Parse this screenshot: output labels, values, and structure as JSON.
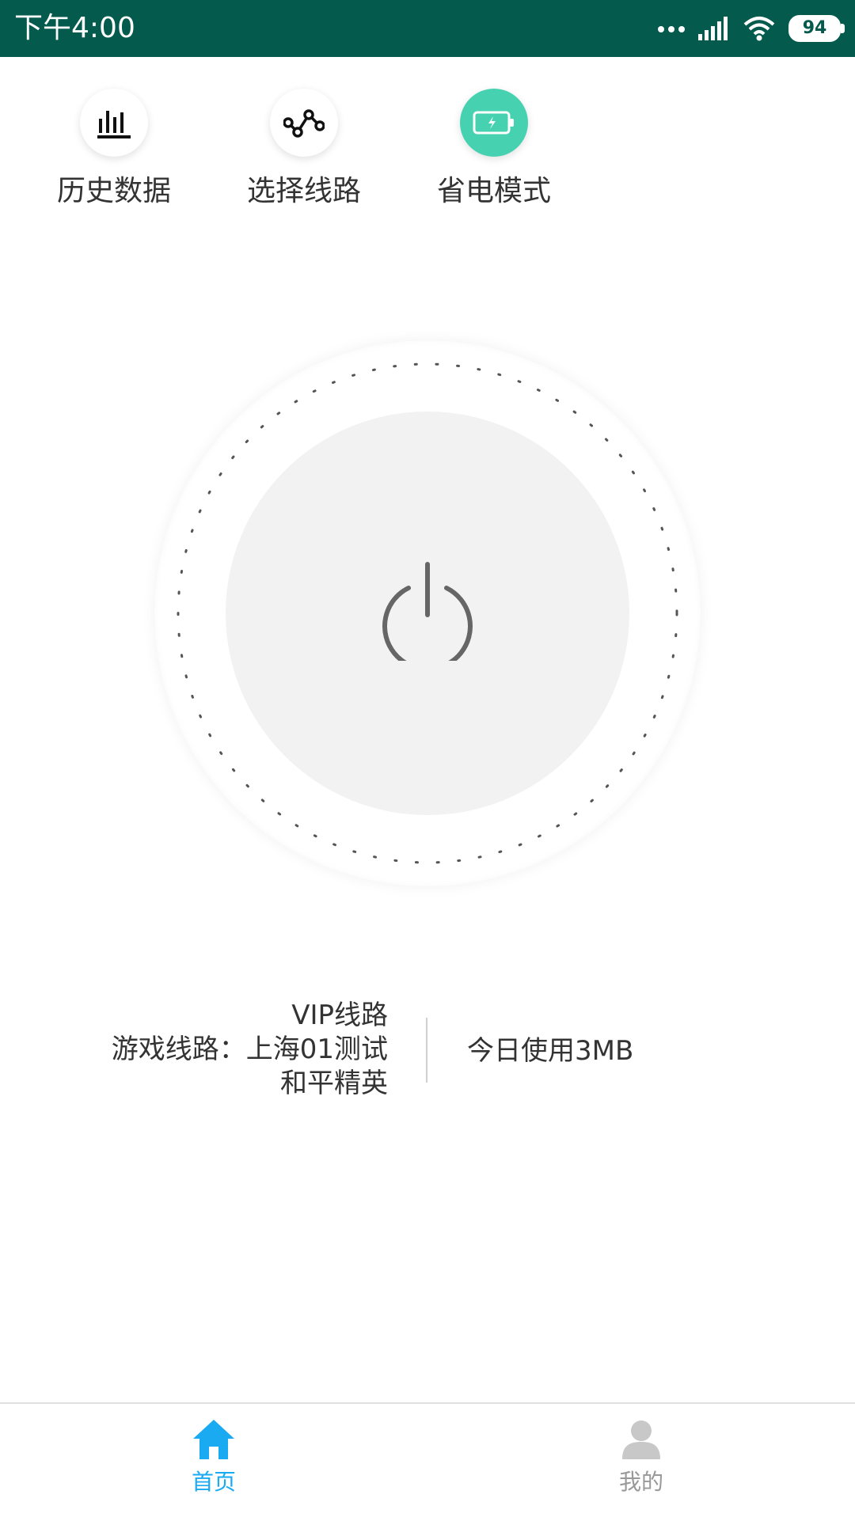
{
  "status_bar": {
    "time": "下午4:00",
    "battery": "94",
    "background": "#035a4d"
  },
  "actions": [
    {
      "label": "历史数据",
      "icon": "bar-chart-icon",
      "active": false
    },
    {
      "label": "选择线路",
      "icon": "route-icon",
      "active": false
    },
    {
      "label": "省电模式",
      "icon": "battery-icon",
      "active": true
    }
  ],
  "power": {
    "icon": "power-icon"
  },
  "info": {
    "line1": "VIP线路",
    "line2": "游戏线路：上海01测试",
    "line3": "和平精英",
    "usage": "今日使用3MB"
  },
  "nav": {
    "home_label": "首页",
    "home_icon": "home-icon",
    "me_label": "我的",
    "me_icon": "user-icon",
    "active_color": "#1aaaf2",
    "inactive_color": "#999999"
  },
  "colors": {
    "accent": "#46d2b0"
  }
}
